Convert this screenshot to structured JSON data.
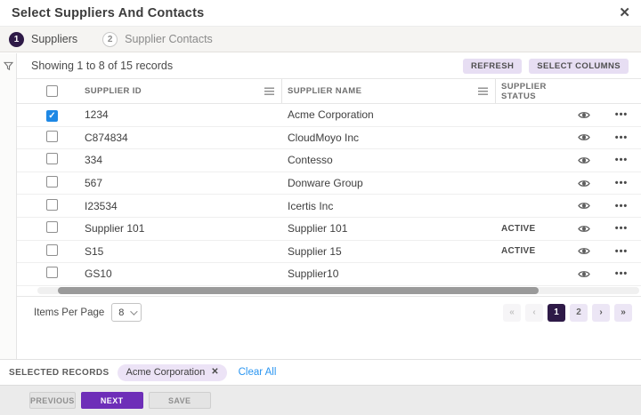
{
  "modal": {
    "title": "Select Suppliers And Contacts",
    "close_icon": "✕"
  },
  "stepper": {
    "steps": [
      {
        "number": "1",
        "label": "Suppliers",
        "active": true
      },
      {
        "number": "2",
        "label": "Supplier Contacts",
        "active": false
      }
    ]
  },
  "toolbar": {
    "showing_text": "Showing 1 to 8 of 15 records",
    "refresh_label": "REFRESH",
    "select_columns_label": "SELECT COLUMNS"
  },
  "table": {
    "columns": {
      "id": "SUPPLIER ID",
      "name": "SUPPLIER NAME",
      "status": "SUPPLIER STATUS"
    },
    "rows": [
      {
        "id": "1234",
        "name": "Acme Corporation",
        "status": "",
        "checked": true
      },
      {
        "id": "C874834",
        "name": "CloudMoyo Inc",
        "status": "",
        "checked": false
      },
      {
        "id": "334",
        "name": "Contesso",
        "status": "",
        "checked": false
      },
      {
        "id": "567",
        "name": "Donware Group",
        "status": "",
        "checked": false
      },
      {
        "id": "I23534",
        "name": "Icertis Inc",
        "status": "",
        "checked": false
      },
      {
        "id": "Supplier 101",
        "name": "Supplier 101",
        "status": "ACTIVE",
        "checked": false
      },
      {
        "id": "S15",
        "name": "Supplier 15",
        "status": "ACTIVE",
        "checked": false
      },
      {
        "id": "GS10",
        "name": "Supplier10",
        "status": "",
        "checked": false
      }
    ]
  },
  "pagination": {
    "items_per_page_label": "Items Per Page",
    "items_per_page_value": "8",
    "first": "«",
    "prev": "‹",
    "page1": "1",
    "page2": "2",
    "next": "›",
    "last": "»",
    "active_page": "1"
  },
  "selected_records": {
    "label": "SELECTED RECORDS",
    "chips": [
      {
        "label": "Acme Corporation",
        "remove_icon": "✕"
      }
    ],
    "clear_all_label": "Clear All"
  },
  "footer": {
    "previous_label": "PREVIOUS",
    "next_label": "NEXT",
    "save_label": "SAVE"
  },
  "colors": {
    "accent_dark_purple": "#2e1a47",
    "accent_purple": "#6e2eb8",
    "lavender": "#e7def3",
    "checkbox_blue": "#1e88e5",
    "link_blue": "#2b96f1",
    "stepper_bg": "#f5f4f2",
    "footer_bg": "#ebebeb"
  }
}
